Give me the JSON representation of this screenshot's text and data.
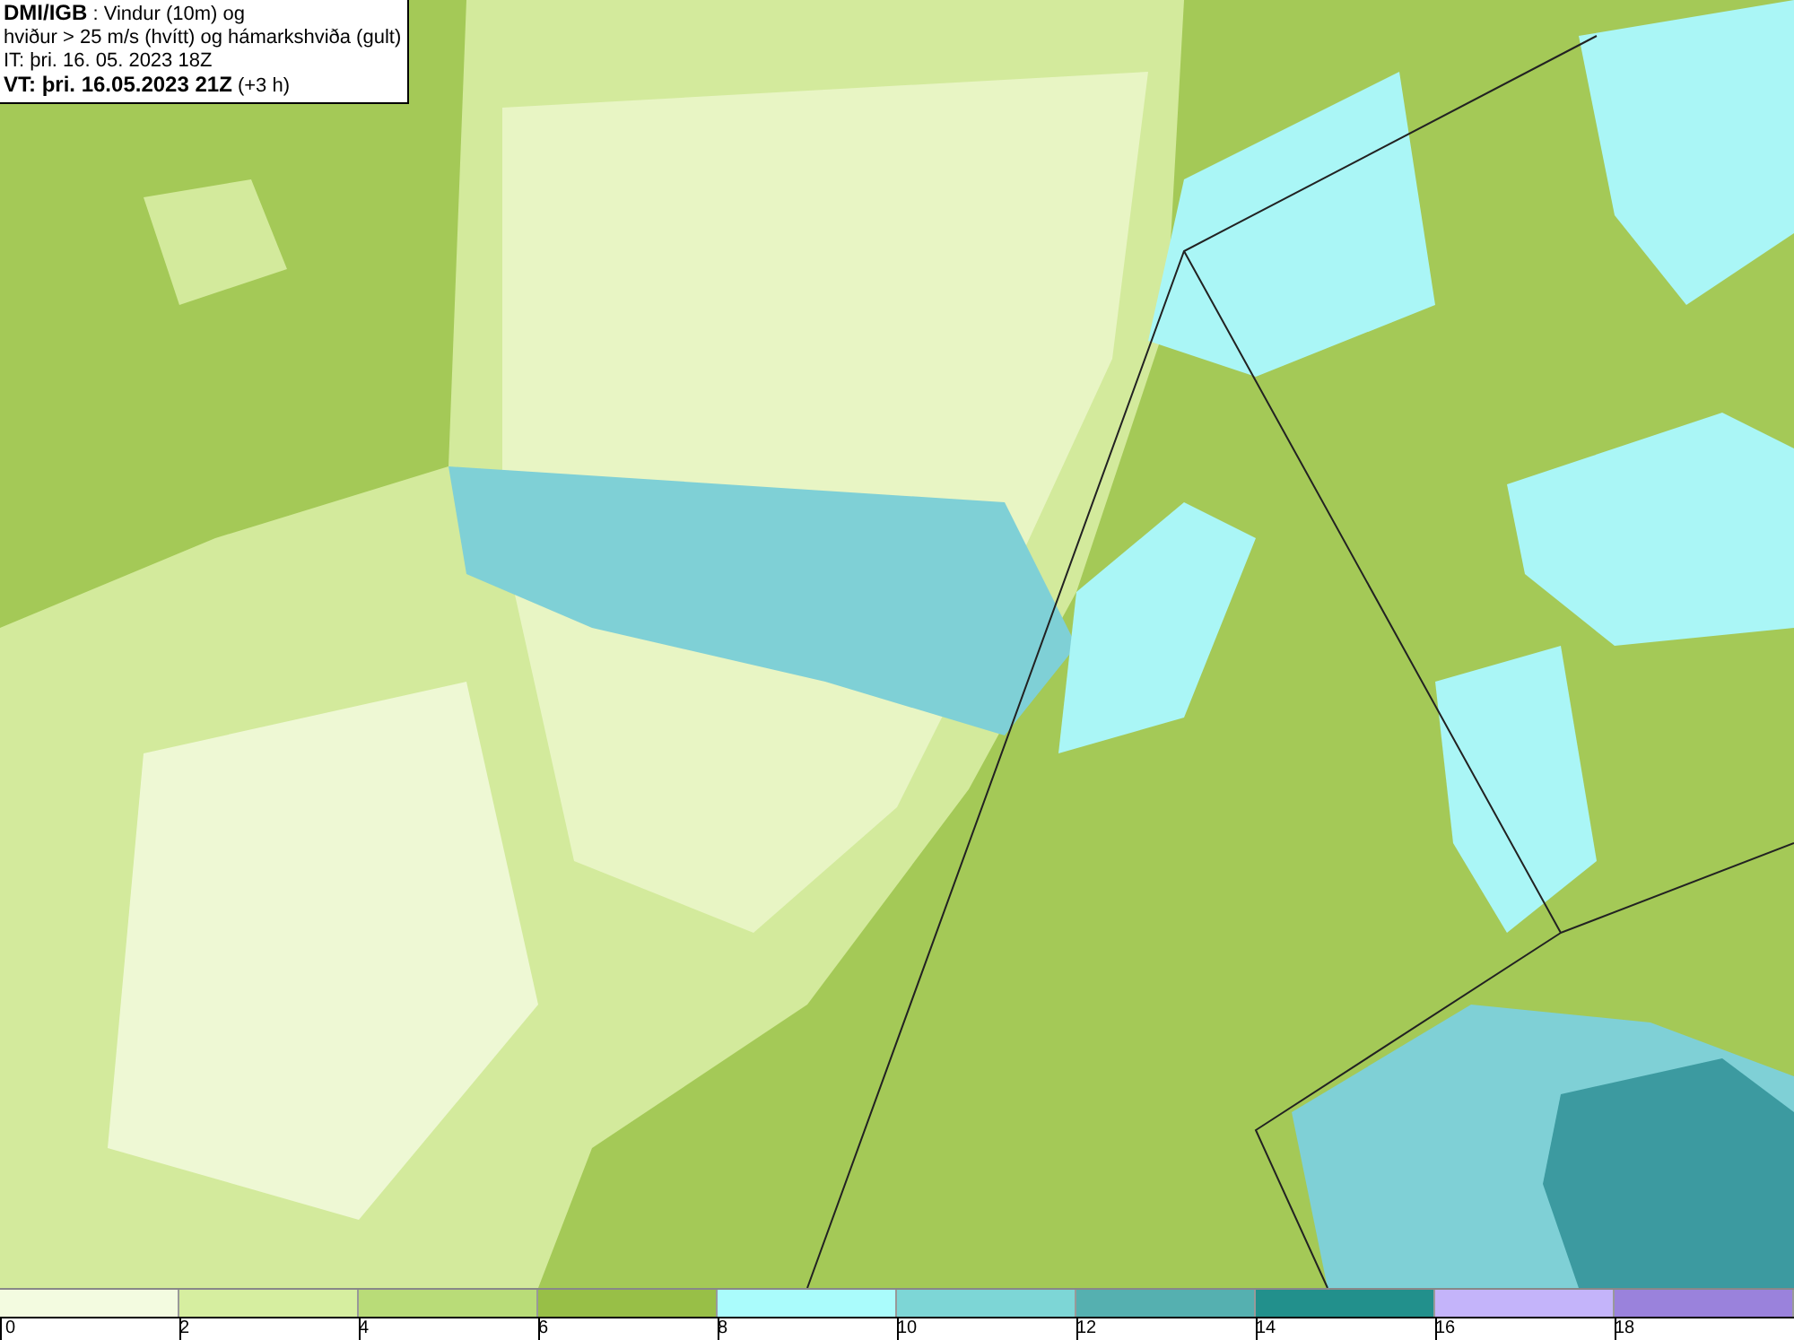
{
  "title_box": {
    "lines": [
      "**DMI/IGB** : Vindur (10m) og",
      "hviður > 25 m/s (hvítt) og hámarkshviða (gult)",
      "IT: þri. 16. 05. 2023 18Z",
      "**VT: þri. 16.05.2023 21Z** (+3 h)"
    ]
  },
  "legend": {
    "bins": [
      {
        "color": "#f3fbe0"
      },
      {
        "color": "#d6eea0"
      },
      {
        "color": "#b9dc78"
      },
      {
        "color": "#98bf47"
      },
      {
        "color": "#aafcfc"
      },
      {
        "color": "#7dd6d6"
      },
      {
        "color": "#55b0b0"
      },
      {
        "color": "#22908c"
      },
      {
        "color": "#c4b4fa"
      },
      {
        "color": "#9a82dc"
      }
    ],
    "labels": [
      "0",
      "2",
      "4",
      "6",
      "8",
      "10",
      "12",
      "14",
      "16",
      "18"
    ]
  }
}
